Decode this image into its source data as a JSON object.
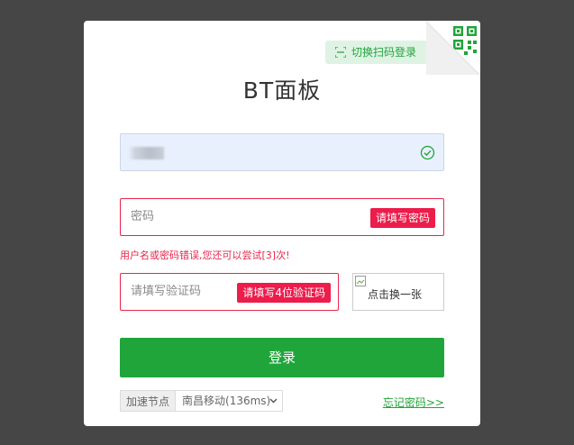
{
  "header": {
    "qr_tip": "切换扫码登录",
    "title": "BT面板"
  },
  "form": {
    "password_placeholder": "密码",
    "password_error": "请填写密码",
    "error_message": "用户名或密码错误,您还可以尝试[3]次!",
    "captcha_placeholder": "请填写验证码",
    "captcha_error": "请填写4位验证码",
    "captcha_alt": "点击换一张",
    "login_label": "登录"
  },
  "footer": {
    "node_label": "加速节点",
    "node_selected": "南昌移动(136ms)",
    "forgot_label": "忘记密码>>"
  },
  "colors": {
    "accent": "#20a53a",
    "error": "#ec1c4b",
    "background": "#464646"
  }
}
